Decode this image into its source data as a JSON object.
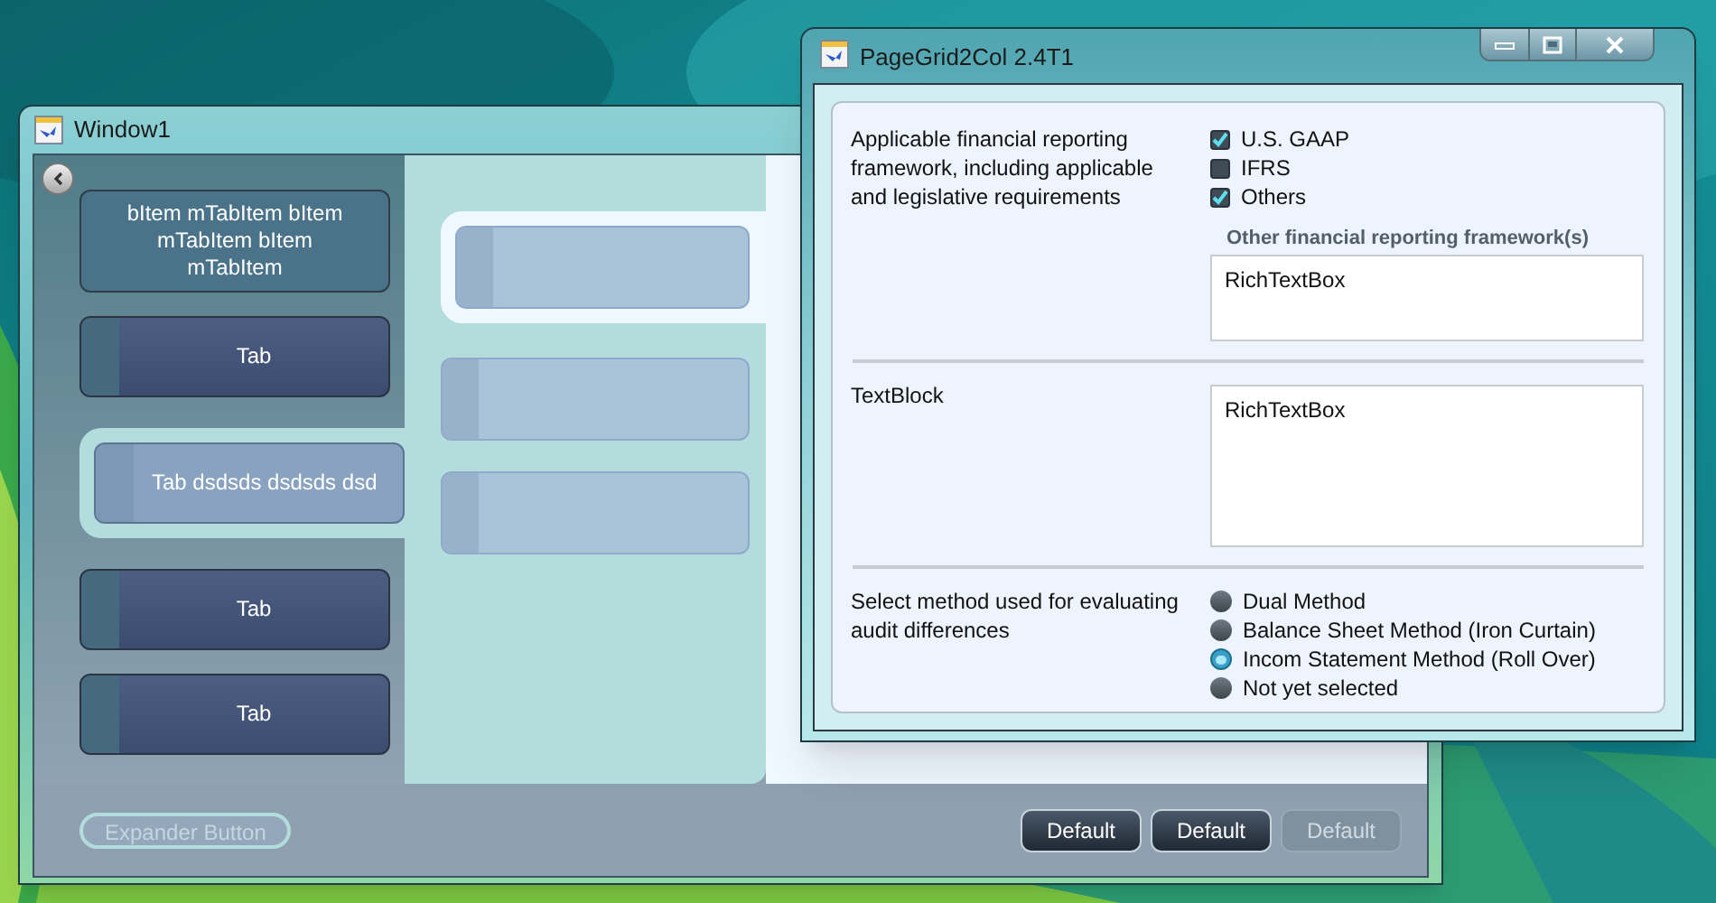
{
  "window1": {
    "title": "Window1",
    "tabs": [
      {
        "label": "bItem mTabItem bItem mTabItem bItem mTabItem",
        "selected": false,
        "hovered": true
      },
      {
        "label": "Tab",
        "selected": false,
        "hovered": false
      },
      {
        "label": "Tab dsdsds dsdsds dsd",
        "selected": true,
        "hovered": false
      },
      {
        "label": "Tab",
        "selected": false,
        "hovered": false
      },
      {
        "label": "Tab",
        "selected": false,
        "hovered": false
      }
    ],
    "panels": [
      {
        "selected": true
      },
      {
        "selected": false
      },
      {
        "selected": false
      }
    ],
    "expander_button": "Expander Button",
    "buttons": [
      {
        "label": "Default",
        "disabled": false
      },
      {
        "label": "Default",
        "disabled": false
      },
      {
        "label": "Default",
        "disabled": true
      }
    ]
  },
  "window2": {
    "title": "PageGrid2Col 2.4T1",
    "sections": [
      {
        "kind": "checkboxes",
        "label": "Applicable financial reporting framework, including applicable and legislative requirements",
        "options": [
          {
            "label": "U.S. GAAP",
            "checked": true
          },
          {
            "label": "IFRS",
            "checked": false
          },
          {
            "label": "Others",
            "checked": true
          }
        ],
        "sublabel": "Other financial reporting framework(s)",
        "value": "RichTextBox"
      },
      {
        "kind": "textbox",
        "label": "TextBlock",
        "value": "RichTextBox"
      },
      {
        "kind": "radios",
        "label": "Select method used for evaluating audit differences",
        "options": [
          {
            "label": "Dual Method",
            "selected": false
          },
          {
            "label": "Balance Sheet Method (Iron Curtain)",
            "selected": false
          },
          {
            "label": "Incom Statement Method (Roll Over)",
            "selected": true
          },
          {
            "label": "Not yet selected",
            "selected": false
          }
        ]
      }
    ]
  }
}
